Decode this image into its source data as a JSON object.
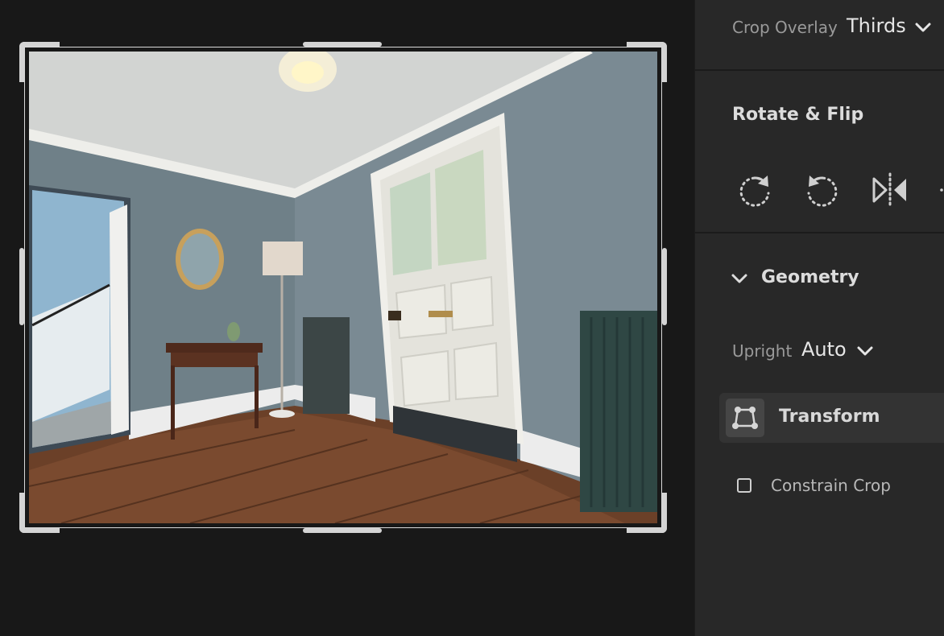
{
  "crop_overlay": {
    "label": "Crop Overlay",
    "value": "Thirds"
  },
  "rotate_flip": {
    "heading": "Rotate & Flip",
    "icons": [
      "rotate-clockwise-icon",
      "rotate-counterclockwise-icon",
      "flip-horizontal-icon",
      "flip-vertical-icon"
    ]
  },
  "geometry": {
    "heading": "Geometry",
    "upright": {
      "label": "Upright",
      "value": "Auto"
    },
    "transform_label": "Transform",
    "constrain_crop": {
      "label": "Constrain Crop",
      "checked": false
    }
  },
  "colors": {
    "canvas_bg": "#181818",
    "panel_bg": "#282828",
    "handle": "#d4d4d4"
  }
}
